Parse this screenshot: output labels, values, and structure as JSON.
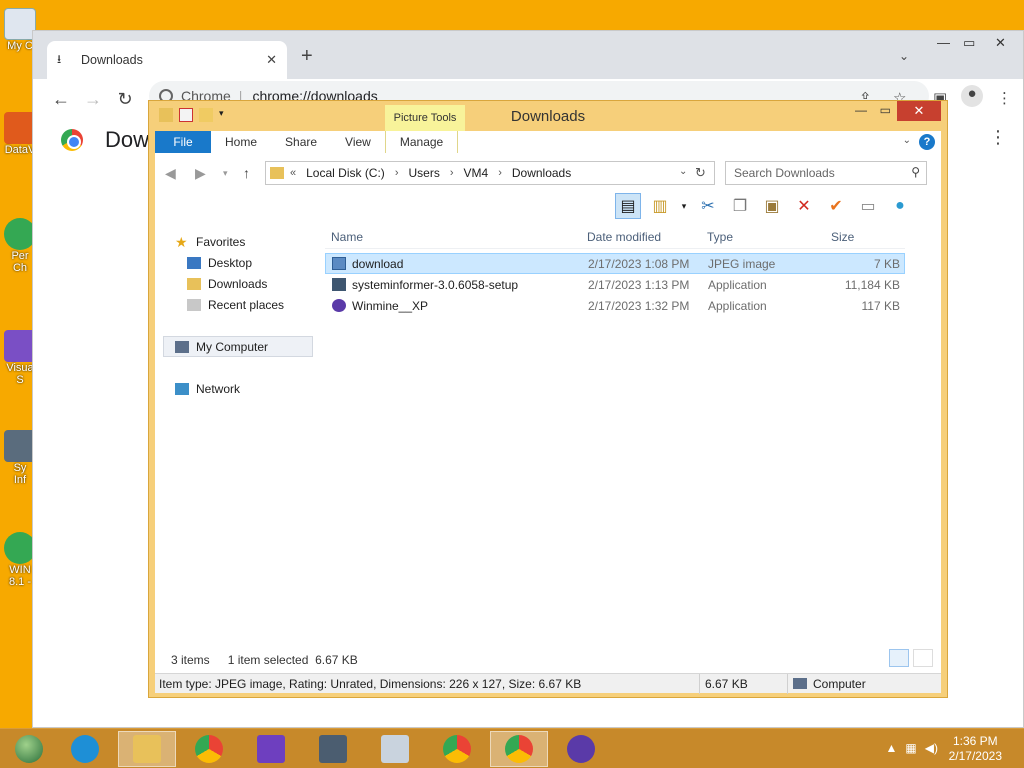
{
  "desktop": {
    "icons": [
      {
        "label": "My C",
        "color": "#dfe6ef"
      },
      {
        "label": "DataV",
        "color": "#e05a1c"
      },
      {
        "label": "Per\nCh",
        "color": "#34a853"
      },
      {
        "label": "Visua\nS",
        "color": "#7a4fc5"
      },
      {
        "label": "Sy\nInf",
        "color": "#5a6c7d"
      },
      {
        "label": "WIN\n8.1 -",
        "color": "#34a853"
      }
    ]
  },
  "chrome": {
    "tab_title": "Downloads",
    "tab_icon": "download-icon",
    "new_tab_label": "+",
    "omnibox_site": "Chrome",
    "omnibox_url": "chrome://downloads",
    "page_title": "Dow"
  },
  "explorer": {
    "title": "Downloads",
    "context_tab": "Picture Tools",
    "ribbon_tabs": [
      "File",
      "Home",
      "Share",
      "View",
      "Manage"
    ],
    "breadcrumb": [
      "Local Disk (C:)",
      "Users",
      "VM4",
      "Downloads"
    ],
    "breadcrumb_prefix": "«",
    "search_placeholder": "Search Downloads",
    "nav": {
      "favorites": "Favorites",
      "desktop": "Desktop",
      "downloads": "Downloads",
      "recent": "Recent places",
      "computer": "My Computer",
      "network": "Network"
    },
    "columns": {
      "name": "Name",
      "date": "Date modified",
      "type": "Type",
      "size": "Size"
    },
    "files": [
      {
        "name": "download",
        "date": "2/17/2023 1:08 PM",
        "type": "JPEG image",
        "size": "7 KB",
        "icon": "image-file-icon"
      },
      {
        "name": "systeminformer-3.0.6058-setup",
        "date": "2/17/2023 1:13 PM",
        "type": "Application",
        "size": "11,184 KB",
        "icon": "setup-app-icon"
      },
      {
        "name": "Winmine__XP",
        "date": "2/17/2023 1:32 PM",
        "type": "Application",
        "size": "117 KB",
        "icon": "mine-icon"
      }
    ],
    "status_items": "3 items",
    "status_selected": "1 item selected",
    "status_selected_size": "6.67 KB",
    "status_details": "Item type: JPEG image, Rating: Unrated, Dimensions: 226 x 127, Size: 6.67 KB",
    "status_size": "6.67 KB",
    "status_location": "Computer"
  },
  "taskbar": {
    "time": "1:36 PM",
    "date": "2/17/2023"
  },
  "colors": {
    "desktop_bg": "#f7a900",
    "explorer_frame": "#f6cf7a",
    "ribbon_file": "#1979ca",
    "selection": "#cce8ff",
    "close_button": "#c7402f"
  }
}
